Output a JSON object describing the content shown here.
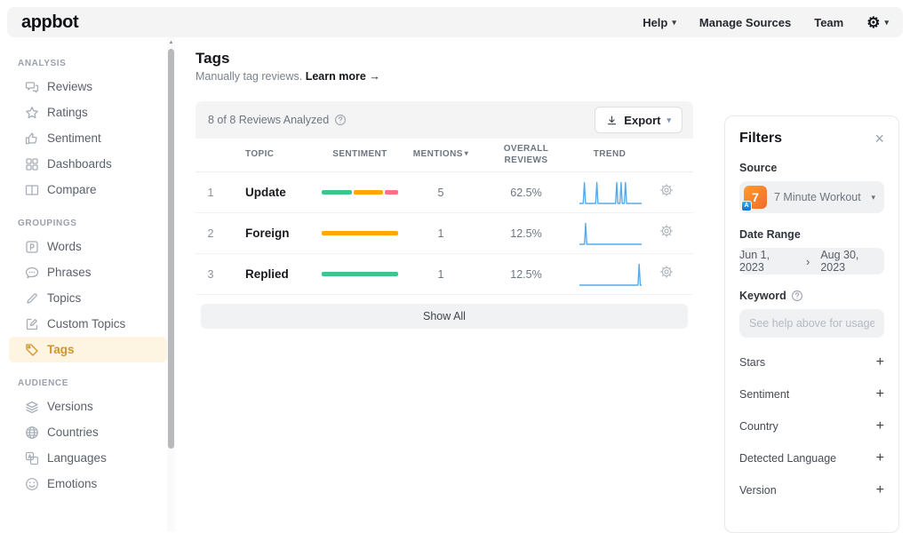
{
  "navbar": {
    "logo": "appbot",
    "help_label": "Help",
    "manage_sources_label": "Manage Sources",
    "team_label": "Team"
  },
  "sidebar": {
    "sections": [
      {
        "title": "ANALYSIS",
        "items": [
          {
            "label": "Reviews",
            "icon": "reviews-icon"
          },
          {
            "label": "Ratings",
            "icon": "star-icon"
          },
          {
            "label": "Sentiment",
            "icon": "thumbs-up-icon"
          },
          {
            "label": "Dashboards",
            "icon": "grid-icon"
          },
          {
            "label": "Compare",
            "icon": "columns-icon"
          }
        ]
      },
      {
        "title": "GROUPINGS",
        "items": [
          {
            "label": "Words",
            "icon": "word-icon"
          },
          {
            "label": "Phrases",
            "icon": "speech-bubble-icon"
          },
          {
            "label": "Topics",
            "icon": "pen-icon"
          },
          {
            "label": "Custom Topics",
            "icon": "edit-square-icon"
          },
          {
            "label": "Tags",
            "icon": "tag-icon",
            "active": true
          }
        ]
      },
      {
        "title": "AUDIENCE",
        "items": [
          {
            "label": "Versions",
            "icon": "layers-icon"
          },
          {
            "label": "Countries",
            "icon": "globe-icon"
          },
          {
            "label": "Languages",
            "icon": "translate-icon"
          },
          {
            "label": "Emotions",
            "icon": "smiley-icon"
          }
        ]
      }
    ]
  },
  "main": {
    "title": "Tags",
    "subtitle": "Manually tag reviews.",
    "learn_more": "Learn more →",
    "panel": {
      "analyzed_text": "8 of 8 Reviews Analyzed",
      "export_label": "Export"
    },
    "table": {
      "columns": [
        "TOPIC",
        "SENTIMENT",
        "MENTIONS",
        "OVERALL REVIEWS",
        "TREND"
      ],
      "rows": [
        {
          "index": "1",
          "topic": "Update",
          "mentions": "5",
          "overall": "62.5%",
          "sentiment": [
            {
              "color": "#3ec48e",
              "frac": 0.42
            },
            {
              "color": "#ffa800",
              "frac": 0.4
            },
            {
              "color": "#fb7185",
              "frac": 0.18
            }
          ],
          "trend_spikes": [
            0.08,
            0.28,
            0.6,
            0.67,
            0.74
          ]
        },
        {
          "index": "2",
          "topic": "Foreign",
          "mentions": "1",
          "overall": "12.5%",
          "sentiment": [
            {
              "color": "#ffa800",
              "frac": 1
            }
          ],
          "trend_spikes": [
            0.1
          ]
        },
        {
          "index": "3",
          "topic": "Replied",
          "mentions": "1",
          "overall": "12.5%",
          "sentiment": [
            {
              "color": "#3ec48e",
              "frac": 1
            }
          ],
          "trend_spikes": [
            0.96
          ]
        }
      ],
      "show_all_label": "Show All"
    }
  },
  "filters": {
    "title": "Filters",
    "source_label": "Source",
    "source_value": "7 Minute Workout",
    "source_app_initial": "7",
    "date_range_label": "Date Range",
    "date_start": "Jun 1, 2023",
    "date_end": "Aug 30, 2023",
    "keyword_label": "Keyword",
    "keyword_placeholder": "See help above for usage",
    "sections": [
      {
        "label": "Stars"
      },
      {
        "label": "Sentiment"
      },
      {
        "label": "Country"
      },
      {
        "label": "Detected Language"
      },
      {
        "label": "Version"
      }
    ]
  },
  "colors": {
    "accent_orange": "#d1952b",
    "active_bg": "#fdf4e1",
    "trend_blue": "#57aae9",
    "positive_green": "#3ec48e",
    "neutral_orange": "#ffa800",
    "negative_red": "#fb7185"
  }
}
